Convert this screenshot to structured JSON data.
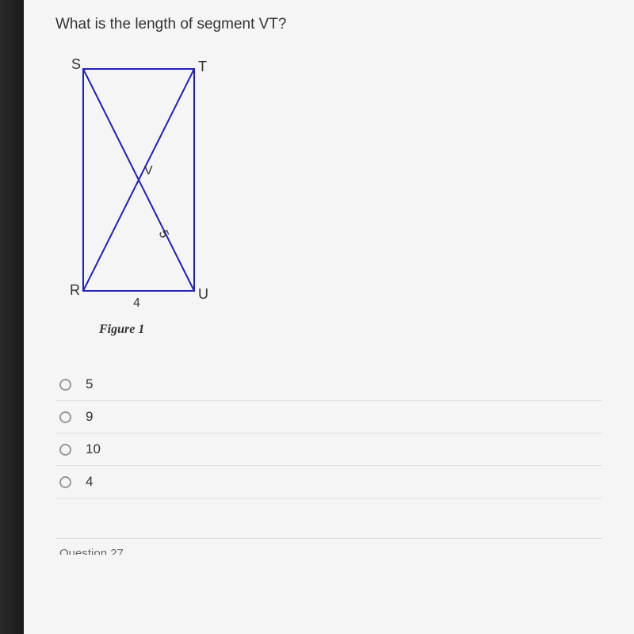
{
  "question": "What is the length of segment VT?",
  "figure": {
    "caption": "Figure 1",
    "labels": {
      "topLeft": "S",
      "topRight": "T",
      "bottomLeft": "R",
      "bottomRight": "U",
      "center": "V",
      "bottomSide": "4",
      "diagonal": "5"
    }
  },
  "answers": {
    "options": [
      "5",
      "9",
      "10",
      "4"
    ]
  },
  "nextQuestion": "Question 27"
}
